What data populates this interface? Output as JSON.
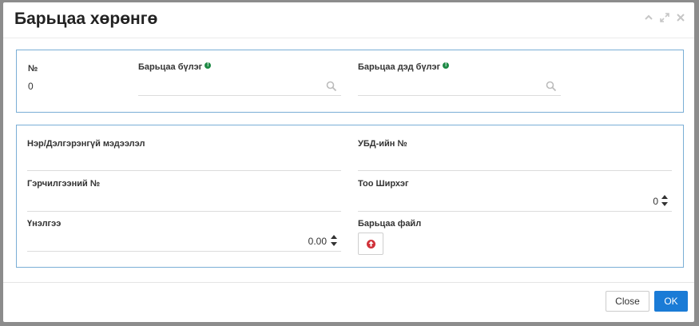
{
  "dialog": {
    "title": "Барьцаа хөрөнгө",
    "window_icons": [
      "collapse-icon",
      "expand-icon",
      "close-icon"
    ]
  },
  "panel1": {
    "number_label": "№",
    "number_value": "0",
    "group_label": "Барьцаа бүлэг",
    "group_value": "",
    "subgroup_label": "Барьцаа дэд бүлэг",
    "subgroup_value": ""
  },
  "panel2": {
    "name_label": "Нэр/Дэлгэрэнгүй мэдээлэл",
    "name_value": "",
    "ubd_label": "УБД-ийн №",
    "ubd_value": "",
    "cert_label": "Гэрчилгээний №",
    "cert_value": "",
    "qty_label": "Тоо Ширхэг",
    "qty_value": "0",
    "appraisal_label": "Үнэлгээ",
    "appraisal_value": "0.00",
    "file_label": "Барьцаа файл"
  },
  "footer": {
    "close_label": "Close",
    "ok_label": "OK"
  },
  "colors": {
    "primary": "#1a7bd6",
    "panel_border": "#7aaed6",
    "info_green": "#1e8a45",
    "upload_red": "#d0323a"
  }
}
